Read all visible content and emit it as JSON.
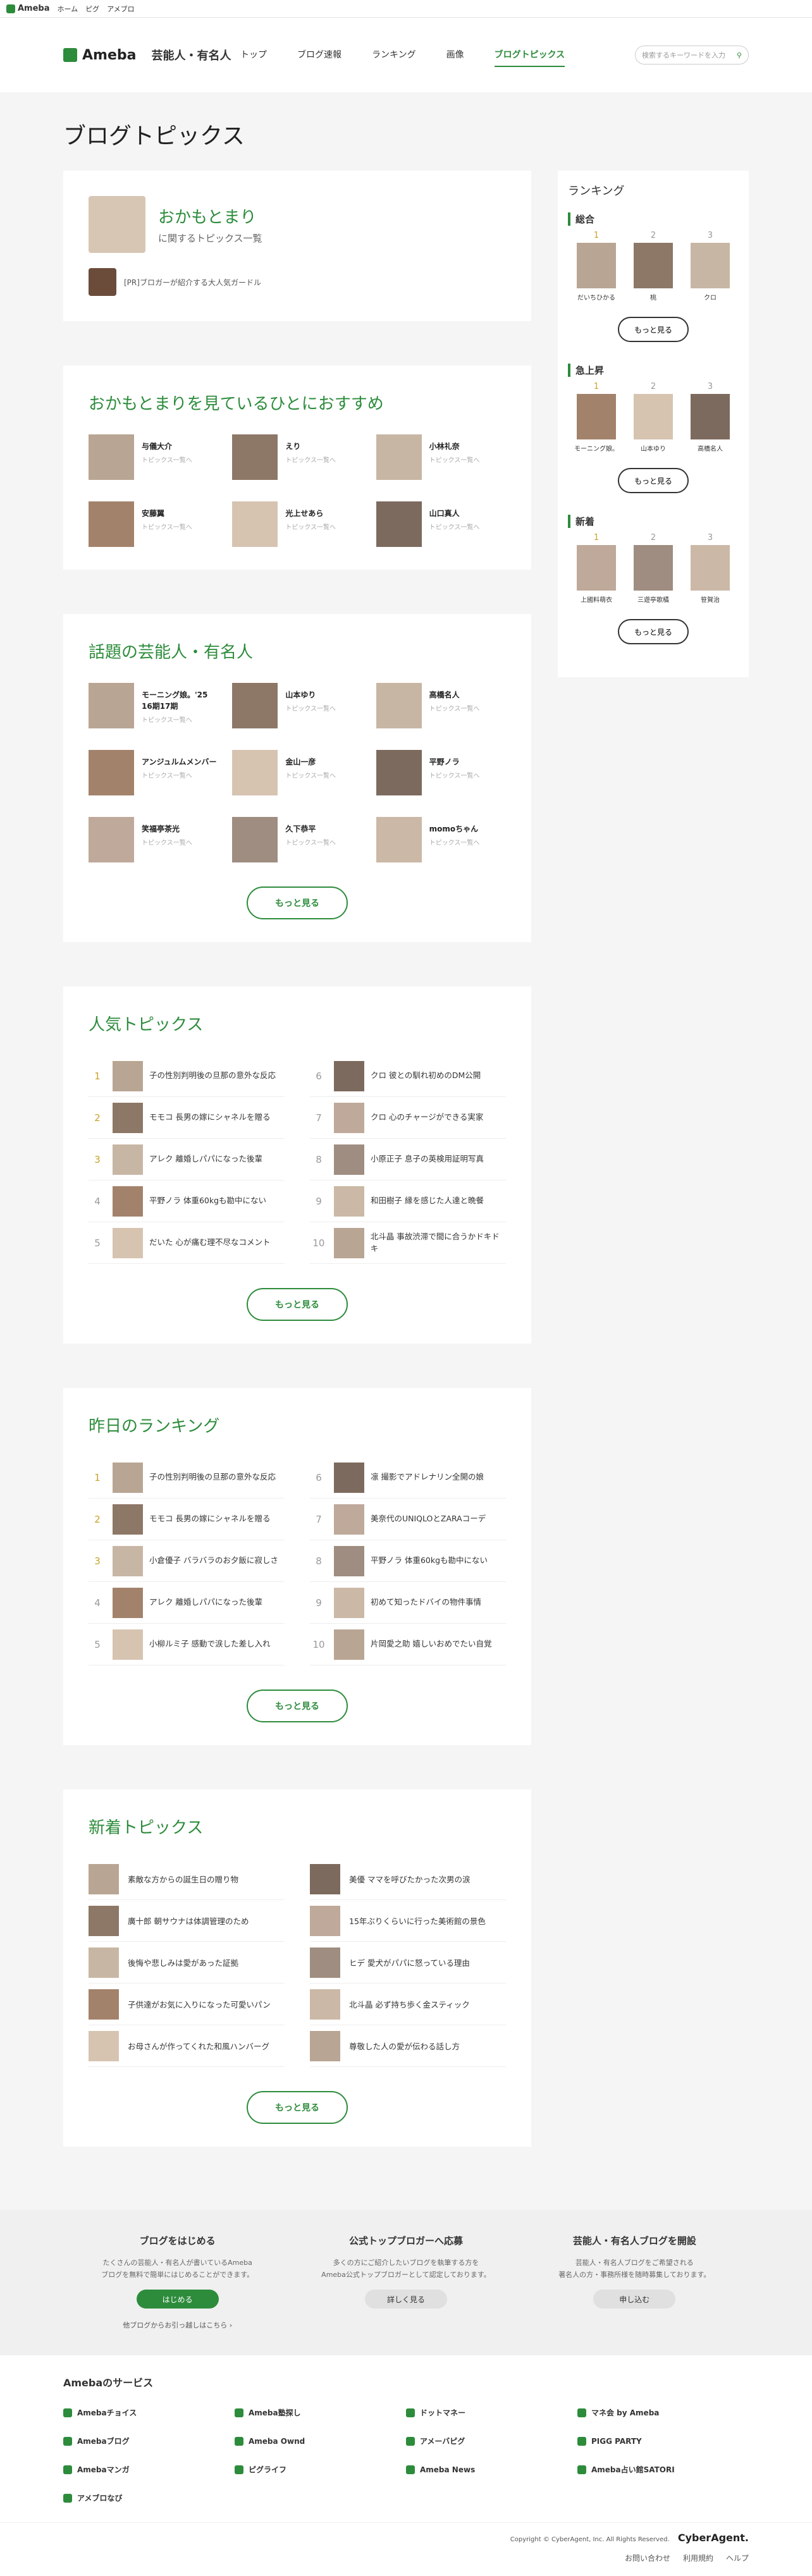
{
  "topbar": {
    "logo": "Ameba",
    "links": [
      "ホーム",
      "ピグ",
      "アメブロ"
    ]
  },
  "nav": {
    "brand": "Ameba",
    "brand_sub": "芸能人・有名人",
    "menu": [
      "トップ",
      "ブログ速報",
      "ランキング",
      "画像",
      "ブログトピックス"
    ],
    "search_placeholder": "検索するキーワードを入力"
  },
  "page_title": "ブログトピックス",
  "profile": {
    "name": "おかもとまり",
    "sub": "に関するトピックス一覧",
    "pr": "[PR]ブロガーが紹介する大人気ガードル"
  },
  "recommend": {
    "title": "おかもとまりを見ているひとにおすすめ",
    "link": "トピックス一覧へ",
    "people": [
      "与儀大介",
      "えり",
      "小林礼奈",
      "安藤翼",
      "光上せあら",
      "山口真人"
    ]
  },
  "trending": {
    "title": "話題の芸能人・有名人",
    "link": "トピックス一覧へ",
    "people": [
      "モーニング娘。'25 16期17期",
      "山本ゆり",
      "高橋名人",
      "アンジュルムメンバー",
      "金山一彦",
      "平野ノラ",
      "笑福亭茶光",
      "久下恭平",
      "momoちゃん"
    ],
    "more": "もっと見る"
  },
  "popular": {
    "title": "人気トピックス",
    "items": [
      {
        "n": "1",
        "t": "子の性別判明後の旦那の意外な反応"
      },
      {
        "n": "2",
        "t": "モモコ 長男の嫁にシャネルを贈る"
      },
      {
        "n": "3",
        "t": "アレク 離婚しパパになった後輩"
      },
      {
        "n": "4",
        "t": "平野ノラ 体重60kgも勘中にない"
      },
      {
        "n": "5",
        "t": "だいた 心が痛む理不尽なコメント"
      },
      {
        "n": "6",
        "t": "クロ 彼との馴れ初めのDM公開"
      },
      {
        "n": "7",
        "t": "クロ 心のチャージができる実家"
      },
      {
        "n": "8",
        "t": "小原正子 息子の英検用証明写真"
      },
      {
        "n": "9",
        "t": "和田樹子 縁を感じた人達と晩餐"
      },
      {
        "n": "10",
        "t": "北斗晶 事故渋滞で間に合うかドキドキ"
      }
    ],
    "more": "もっと見る"
  },
  "yesterday": {
    "title": "昨日のランキング",
    "items": [
      {
        "n": "1",
        "t": "子の性別判明後の旦那の意外な反応"
      },
      {
        "n": "2",
        "t": "モモコ 長男の嫁にシャネルを贈る"
      },
      {
        "n": "3",
        "t": "小倉優子 バラバラのお夕飯に寂しさ"
      },
      {
        "n": "4",
        "t": "アレク 離婚しパパになった後輩"
      },
      {
        "n": "5",
        "t": "小柳ルミ子 感動で涙した差し入れ"
      },
      {
        "n": "6",
        "t": "凛 撮影でアドレナリン全開の娘"
      },
      {
        "n": "7",
        "t": "美奈代のUNIQLOとZARAコーデ"
      },
      {
        "n": "8",
        "t": "平野ノラ 体重60kgも勘中にない"
      },
      {
        "n": "9",
        "t": "初めて知ったドバイの物件事情"
      },
      {
        "n": "10",
        "t": "片岡愛之助 嬉しいおめでたい自覚"
      }
    ],
    "more": "もっと見る"
  },
  "latest": {
    "title": "新着トピックス",
    "items": [
      "素敵な方からの誕生日の贈り物",
      "廣十郎 朝サウナは体調管理のため",
      "後悔や悲しみは愛があった証拠",
      "子供達がお気に入りになった可愛いパン",
      "お母さんが作ってくれた和風ハンバーグ",
      "美優 ママを呼びたかった次男の涙",
      "15年ぶりくらいに行った美術館の景色",
      "ヒデ 愛犬がパパに怒っている理由",
      "北斗晶 必ず持ち歩く金スティック",
      "尊敬した人の愛が伝わる話し方"
    ],
    "more": "もっと見る"
  },
  "side": {
    "title": "ランキング",
    "groups": [
      {
        "label": "総合",
        "names": [
          "だいちひかる",
          "桃",
          "クロ"
        ]
      },
      {
        "label": "急上昇",
        "names": [
          "モーニング娘。",
          "山本ゆり",
          "高橋名人"
        ]
      },
      {
        "label": "新着",
        "names": [
          "上國料萌衣",
          "三遊亭歌橘",
          "笹賀治"
        ]
      }
    ],
    "ranks": [
      "1",
      "2",
      "3"
    ],
    "more": "もっと見る"
  },
  "cta": [
    {
      "title": "ブログをはじめる",
      "desc1": "たくさんの芸能人・有名人が書いているAmeba",
      "desc2": "ブログを無料で簡単にはじめることができます。",
      "btn": "はじめる",
      "link": "他ブログからお引っ越しはこちら ›"
    },
    {
      "title": "公式トップブロガーへ応募",
      "desc1": "多くの方にご紹介したいブログを執筆する方を",
      "desc2": "Ameba公式トップブロガーとして認定しております。",
      "btn": "詳しく見る"
    },
    {
      "title": "芸能人・有名人ブログを開設",
      "desc1": "芸能人・有名人ブログをご希望される",
      "desc2": "著名人の方・事務所様を随時募集しております。",
      "btn": "申し込む"
    }
  ],
  "services": {
    "title": "Amebaのサービス",
    "items": [
      "Amebaチョイス",
      "Ameba塾探し",
      "ドットマネー",
      "マネ会 by Ameba",
      "Amebaブログ",
      "Ameba Ownd",
      "アメーバピグ",
      "PIGG PARTY",
      "Amebaマンガ",
      "ピグライフ",
      "Ameba News",
      "Ameba占い館SATORI",
      "アメブロなび"
    ]
  },
  "footer": {
    "copyright": "Copyright © CyberAgent, Inc. All Rights Reserved.",
    "brand": "CyberAgent.",
    "links": [
      "お問い合わせ",
      "利用規約",
      "ヘルプ"
    ]
  },
  "colors": {
    "accent": "#2d8c3c",
    "crown": "#c9a227"
  }
}
